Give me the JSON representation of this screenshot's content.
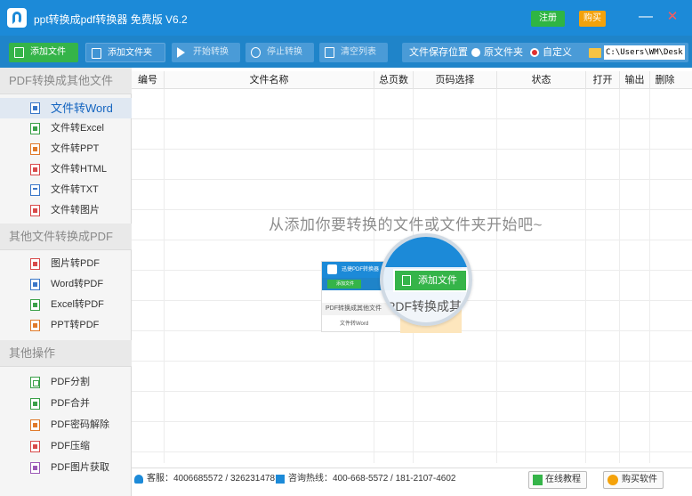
{
  "window": {
    "title": "ppt转换成pdf转换器 免费版 V6.2",
    "register_label": "注册",
    "buy_label": "购买",
    "minimize_glyph": "—",
    "close_glyph": "✕"
  },
  "toolbar": {
    "add_file": "添加文件",
    "add_folder": "添加文件夹",
    "start_convert": "开始转换",
    "stop_convert": "停止转换",
    "clear_list": "清空列表",
    "save_location_label": "文件保存位置",
    "option_original": "原文件夹",
    "option_custom": "自定义",
    "path_value": "C:\\Users\\WM\\Desk"
  },
  "sidebar": {
    "section1": "PDF转换成其他文件",
    "section1_items": [
      "文件转Word",
      "文件转Excel",
      "文件转PPT",
      "文件转HTML",
      "文件转TXT",
      "文件转图片"
    ],
    "section2": "其他文件转换成PDF",
    "section2_items": [
      "图片转PDF",
      "Word转PDF",
      "Excel转PDF",
      "PPT转PDF"
    ],
    "section3": "其他操作",
    "section3_items": [
      "PDF分割",
      "PDF合并",
      "PDF密码解除",
      "PDF压缩",
      "PDF图片获取"
    ]
  },
  "table": {
    "columns": [
      "编号",
      "文件名称",
      "总页数",
      "页码选择",
      "状态",
      "打开",
      "输出",
      "删除"
    ],
    "empty_hint": "从添加你要转换的文件或文件夹开始吧~"
  },
  "illustration": {
    "app_name": "迅捷PDF转换器",
    "add_file": "添加文件",
    "sidebar_header": "PDF转换成其他文件",
    "sidebar_item": "文件转Word",
    "zoom_text": "PDF转换成其"
  },
  "statusbar": {
    "service": "客服：4006685572 / 326231478",
    "hotline": "咨询热线：400-668-5572 / 181-2107-4602",
    "tutorial": "在线教程",
    "buy": "购买软件"
  }
}
